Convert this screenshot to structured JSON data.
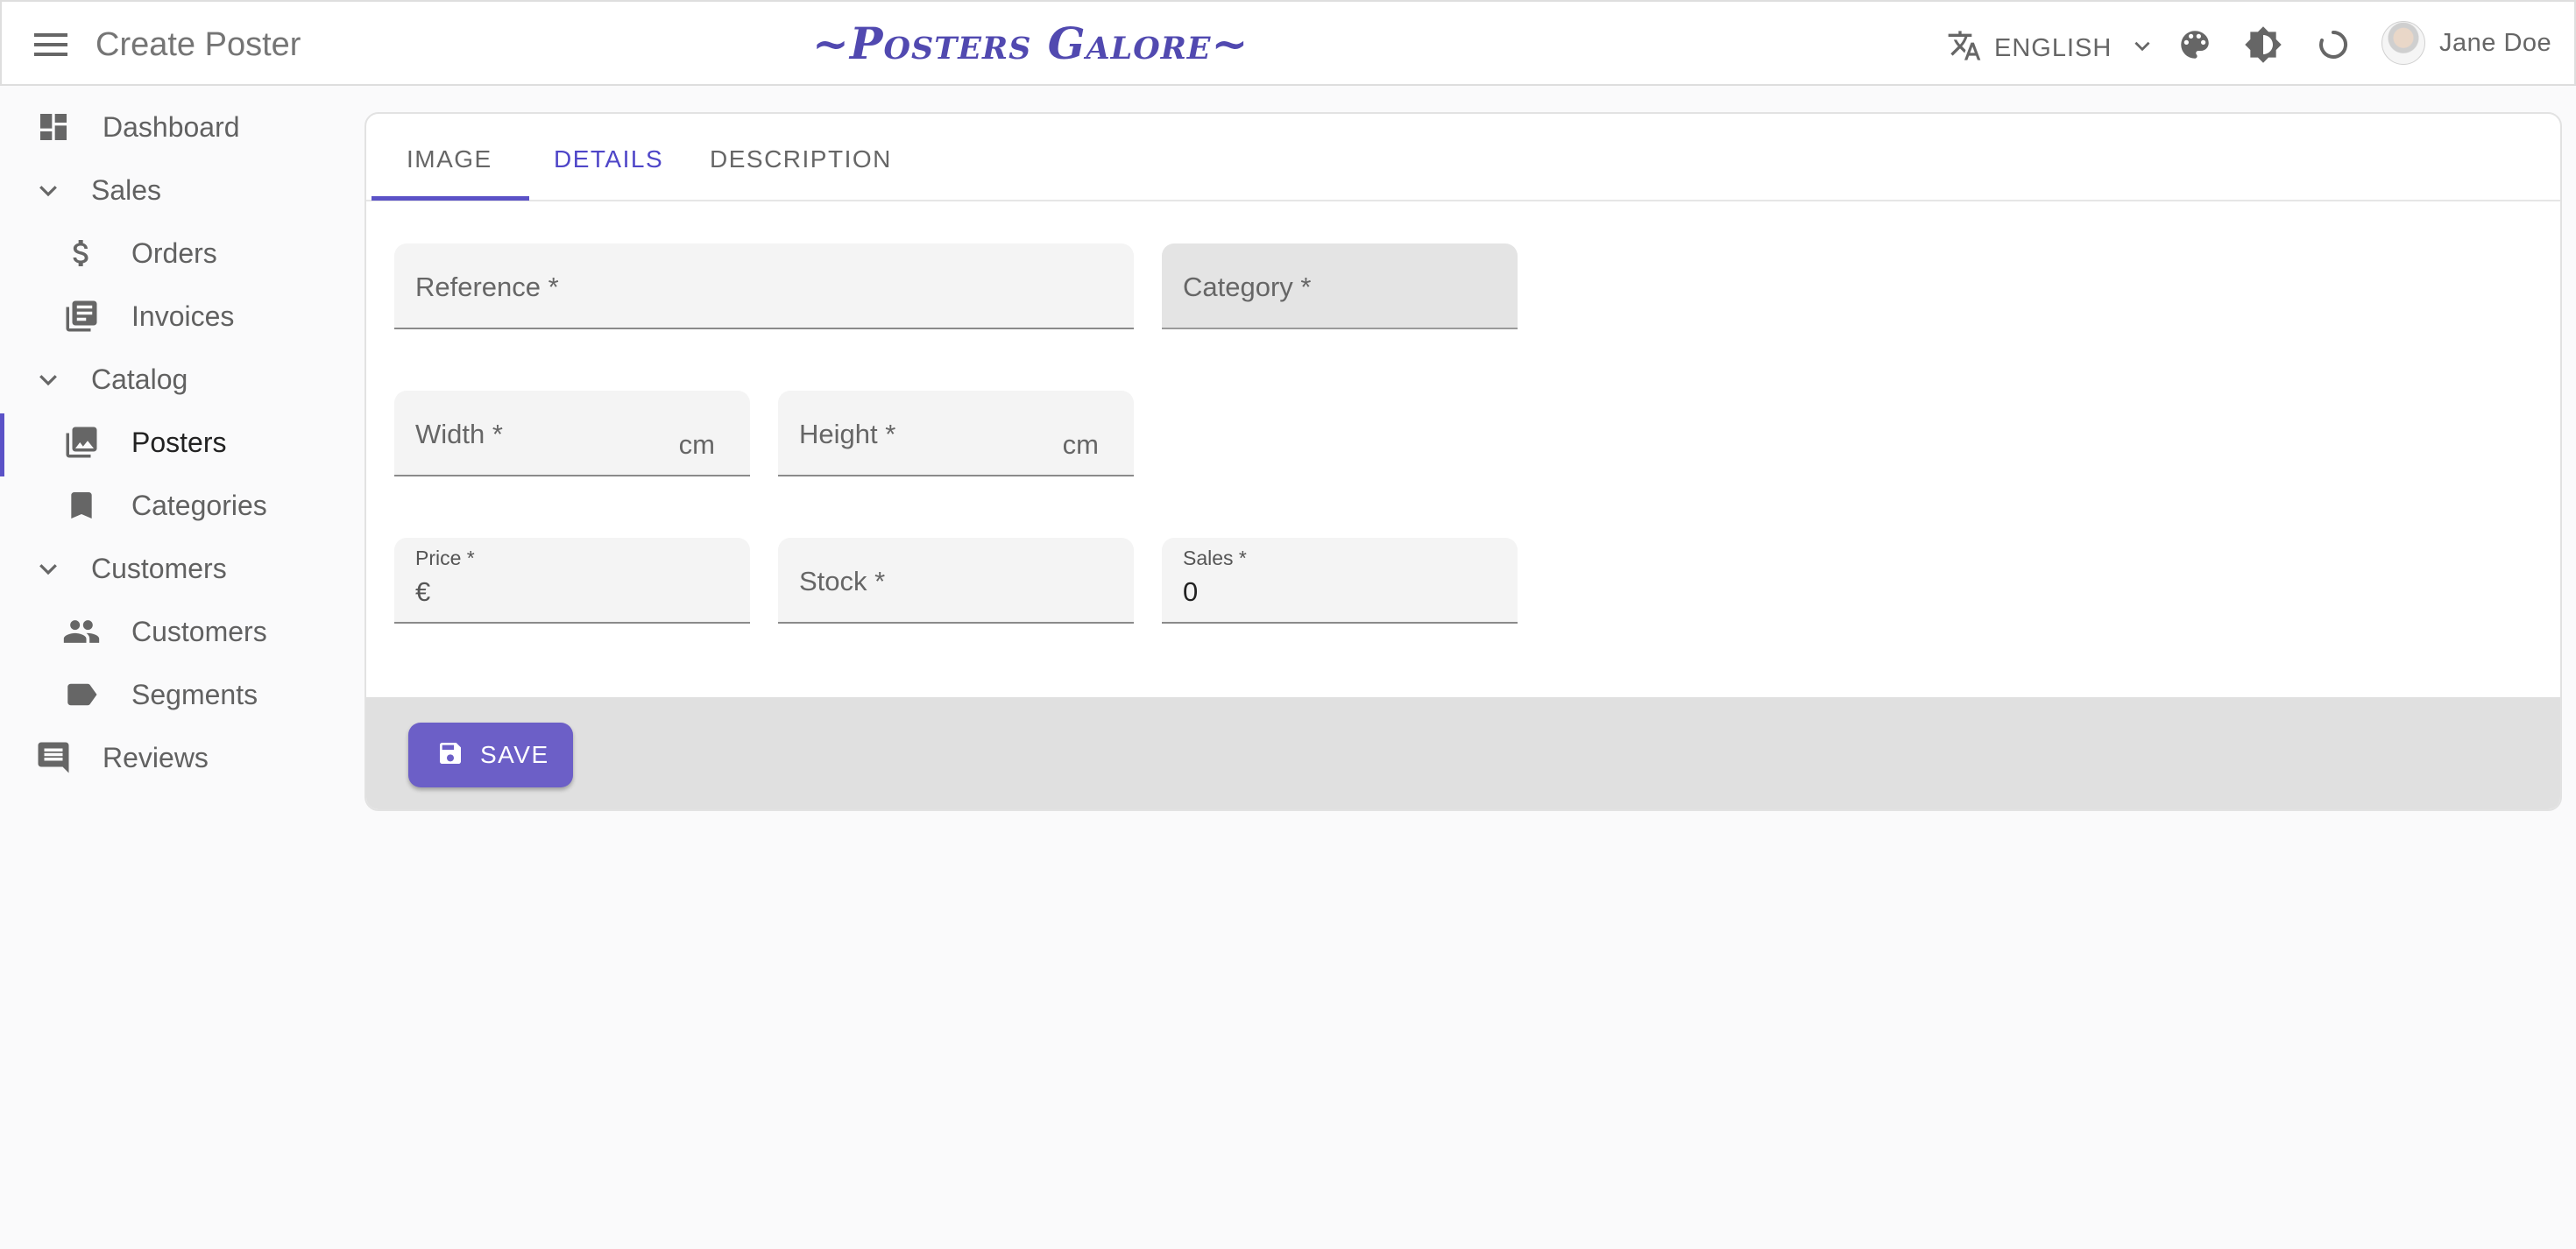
{
  "header": {
    "page_title": "Create Poster",
    "brand": "~Posters Galore~",
    "language": "ENGLISH",
    "user_name": "Jane Doe"
  },
  "sidebar": {
    "items": [
      {
        "label": "Dashboard",
        "icon": "dashboard-icon"
      },
      {
        "label": "Sales",
        "icon": "chevron-down-icon"
      },
      {
        "label": "Orders",
        "icon": "dollar-icon"
      },
      {
        "label": "Invoices",
        "icon": "invoices-icon"
      },
      {
        "label": "Catalog",
        "icon": "chevron-down-icon"
      },
      {
        "label": "Posters",
        "icon": "image-collection-icon",
        "active": true
      },
      {
        "label": "Categories",
        "icon": "bookmark-icon"
      },
      {
        "label": "Customers",
        "icon": "chevron-down-icon"
      },
      {
        "label": "Customers",
        "icon": "people-icon"
      },
      {
        "label": "Segments",
        "icon": "label-icon"
      },
      {
        "label": "Reviews",
        "icon": "comment-icon"
      }
    ]
  },
  "tabs": [
    {
      "label": "IMAGE"
    },
    {
      "label": "DETAILS"
    },
    {
      "label": "DESCRIPTION"
    }
  ],
  "form": {
    "reference": {
      "label": "Reference *"
    },
    "category": {
      "label": "Category *"
    },
    "width": {
      "label": "Width *",
      "unit": "cm"
    },
    "height": {
      "label": "Height *",
      "unit": "cm"
    },
    "price": {
      "label": "Price *",
      "prefix": "€"
    },
    "stock": {
      "label": "Stock *"
    },
    "sales": {
      "label": "Sales *",
      "value": "0"
    }
  },
  "toolbar": {
    "save_label": "SAVE"
  },
  "colors": {
    "accent": "#5b52c7",
    "brand": "#5149b0",
    "save_button": "#6c5fc7"
  }
}
